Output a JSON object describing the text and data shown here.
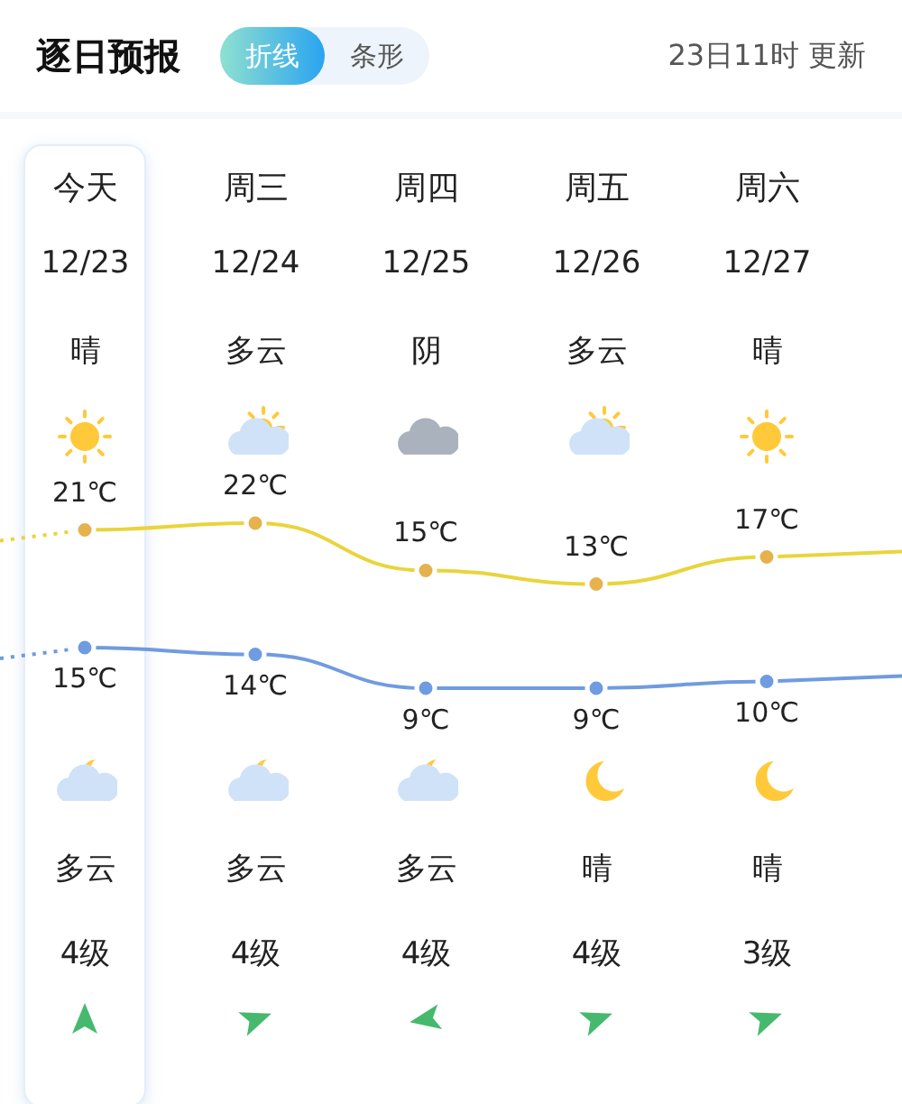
{
  "header": {
    "title": "逐日预报",
    "tabs": [
      {
        "label": "折线",
        "selected": true
      },
      {
        "label": "条形",
        "selected": false
      }
    ],
    "updated": "23日11时 更新"
  },
  "days": [
    {
      "name": "今天",
      "date": "12/23",
      "day_weather": "晴",
      "day_icon": {
        "kind": "sun"
      },
      "high": "21℃",
      "low": "15℃",
      "night_icon": {
        "kind": "moon-cloud"
      },
      "night_weather": "多云",
      "wind": "4级",
      "wind_arrow": {
        "kind": "up"
      },
      "selected": true
    },
    {
      "name": "周三",
      "date": "12/24",
      "day_weather": "多云",
      "day_icon": {
        "kind": "sun-cloud"
      },
      "high": "22℃",
      "low": "14℃",
      "night_icon": {
        "kind": "moon-cloud"
      },
      "night_weather": "多云",
      "wind": "4级",
      "wind_arrow": {
        "kind": "right"
      },
      "selected": false
    },
    {
      "name": "周四",
      "date": "12/25",
      "day_weather": "阴",
      "day_icon": {
        "kind": "cloud"
      },
      "high": "15℃",
      "low": "9℃",
      "night_icon": {
        "kind": "moon-cloud"
      },
      "night_weather": "多云",
      "wind": "4级",
      "wind_arrow": {
        "kind": "left"
      },
      "selected": false
    },
    {
      "name": "周五",
      "date": "12/26",
      "day_weather": "多云",
      "day_icon": {
        "kind": "sun-cloud"
      },
      "high": "13℃",
      "low": "9℃",
      "night_icon": {
        "kind": "moon"
      },
      "night_weather": "晴",
      "wind": "4级",
      "wind_arrow": {
        "kind": "right"
      },
      "selected": false
    },
    {
      "name": "周六",
      "date": "12/27",
      "day_weather": "晴",
      "day_icon": {
        "kind": "sun"
      },
      "high": "17℃",
      "low": "10℃",
      "night_icon": {
        "kind": "moon"
      },
      "night_weather": "晴",
      "wind": "3级",
      "wind_arrow": {
        "kind": "right"
      },
      "selected": false
    }
  ]
}
